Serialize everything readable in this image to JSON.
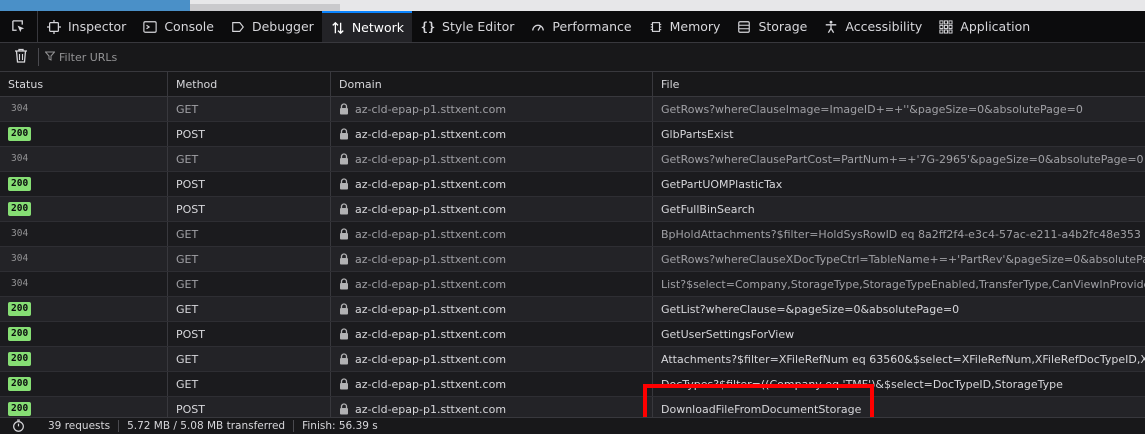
{
  "tabs": [
    {
      "label": "Inspector",
      "icon": "inspector-icon"
    },
    {
      "label": "Console",
      "icon": "console-icon"
    },
    {
      "label": "Debugger",
      "icon": "debugger-icon"
    },
    {
      "label": "Network",
      "icon": "network-icon",
      "active": true
    },
    {
      "label": "Style Editor",
      "icon": "style-editor-icon"
    },
    {
      "label": "Performance",
      "icon": "performance-icon"
    },
    {
      "label": "Memory",
      "icon": "memory-icon"
    },
    {
      "label": "Storage",
      "icon": "storage-icon"
    },
    {
      "label": "Accessibility",
      "icon": "accessibility-icon"
    },
    {
      "label": "Application",
      "icon": "application-icon"
    }
  ],
  "filter": {
    "placeholder": "Filter URLs"
  },
  "columns": {
    "status": "Status",
    "method": "Method",
    "domain": "Domain",
    "file": "File"
  },
  "rows": [
    {
      "status": "304",
      "method": "GET",
      "domain": "az-cld-epap-p1.sttxent.com",
      "file": "GetRows?whereClauseImage=ImageID+=+''&pageSize=0&absolutePage=0"
    },
    {
      "status": "200",
      "method": "POST",
      "domain": "az-cld-epap-p1.sttxent.com",
      "file": "GlbPartsExist"
    },
    {
      "status": "304",
      "method": "GET",
      "domain": "az-cld-epap-p1.sttxent.com",
      "file": "GetRows?whereClausePartCost=PartNum+=+'7G-2965'&pageSize=0&absolutePage=0"
    },
    {
      "status": "200",
      "method": "POST",
      "domain": "az-cld-epap-p1.sttxent.com",
      "file": "GetPartUOMPlasticTax"
    },
    {
      "status": "200",
      "method": "POST",
      "domain": "az-cld-epap-p1.sttxent.com",
      "file": "GetFullBinSearch"
    },
    {
      "status": "304",
      "method": "GET",
      "domain": "az-cld-epap-p1.sttxent.com",
      "file": "BpHoldAttachments?$filter=HoldSysRowID eq 8a2ff2f4-e3c4-57ac-e211-a4b2fc48e353"
    },
    {
      "status": "304",
      "method": "GET",
      "domain": "az-cld-epap-p1.sttxent.com",
      "file": "GetRows?whereClauseXDocTypeCtrl=TableName+=+'PartRev'&pageSize=0&absolutePage=0"
    },
    {
      "status": "304",
      "method": "GET",
      "domain": "az-cld-epap-p1.sttxent.com",
      "file": "List?$select=Company,StorageType,StorageTypeEnabled,TransferType,CanViewInProvider,CompanyD"
    },
    {
      "status": "200",
      "method": "GET",
      "domain": "az-cld-epap-p1.sttxent.com",
      "file": "GetList?whereClause=&pageSize=0&absolutePage=0"
    },
    {
      "status": "200",
      "method": "POST",
      "domain": "az-cld-epap-p1.sttxent.com",
      "file": "GetUserSettingsForView"
    },
    {
      "status": "200",
      "method": "GET",
      "domain": "az-cld-epap-p1.sttxent.com",
      "file": "Attachments?$filter=XFileRefNum eq 63560&$select=XFileRefNum,XFileRefDocTypeID,XFileRefXFileN"
    },
    {
      "status": "200",
      "method": "GET",
      "domain": "az-cld-epap-p1.sttxent.com",
      "file": "DocTypes?$filter=((Company eq 'TMF')&$select=DocTypeID,StorageType"
    },
    {
      "status": "200",
      "method": "POST",
      "domain": "az-cld-epap-p1.sttxent.com",
      "file": "DownloadFileFromDocumentStorage"
    }
  ],
  "statusbar": {
    "requests": "39 requests",
    "transferred": "5.72 MB / 5.08 MB transferred",
    "finish": "Finish: 56.39 s"
  },
  "colors": {
    "accent": "#0a84ff",
    "ok_badge": "#86de74",
    "highlight": "#ff0000"
  }
}
